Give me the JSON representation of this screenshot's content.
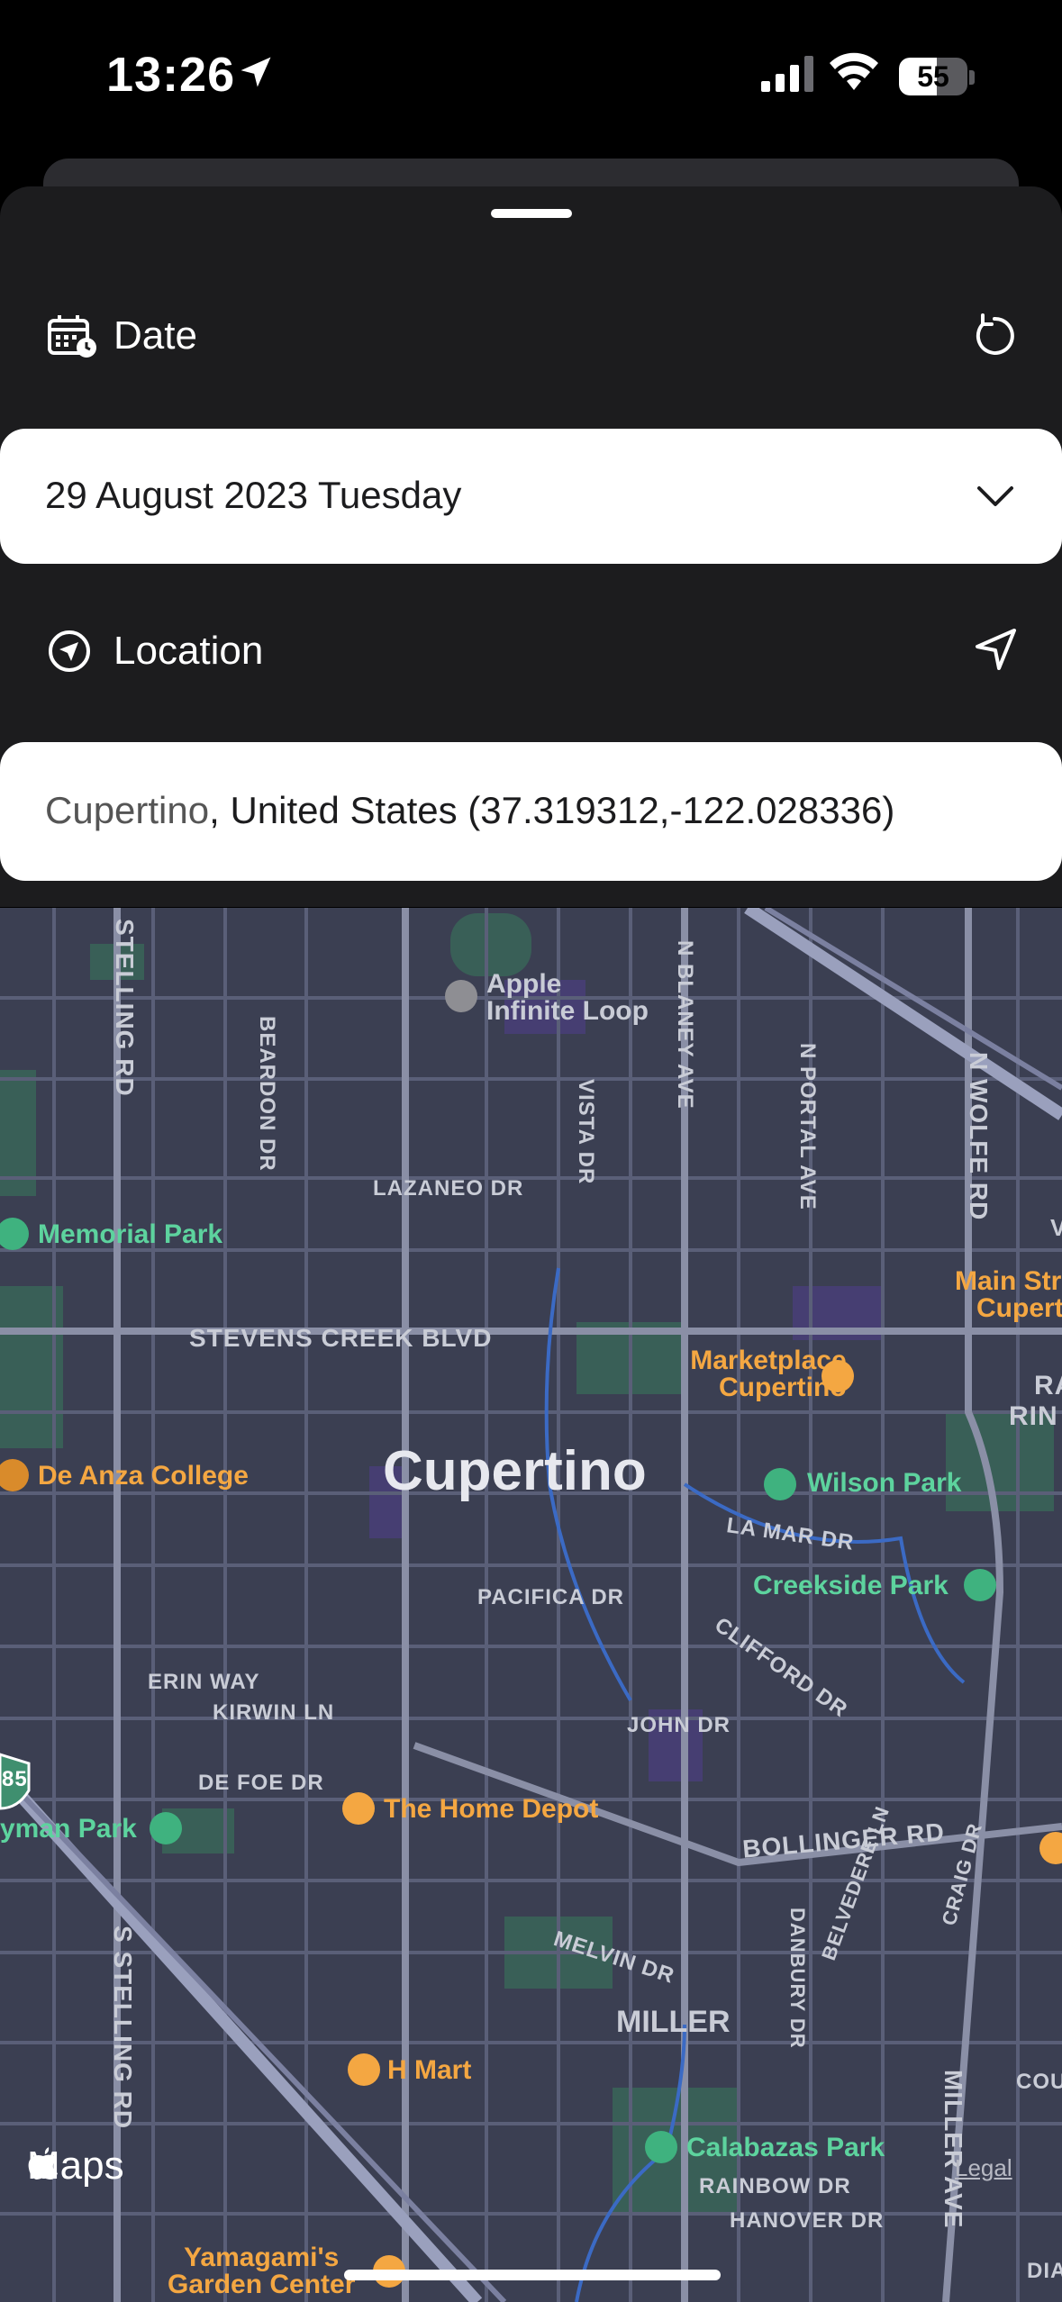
{
  "status_bar": {
    "time": "13:26",
    "battery": "55",
    "battery_level": 0.55
  },
  "date_section": {
    "label": "Date",
    "value": "29 August 2023 Tuesday"
  },
  "location_section": {
    "label": "Location",
    "place": "Cupertino",
    "rest": ", United States (37.319312,-122.028336)"
  },
  "map": {
    "city": "Cupertino",
    "district": "MILLER",
    "attribution": "Maps",
    "legal": "Legal",
    "highway_shield": "85",
    "streets": {
      "stelling_top": "STELLING RD",
      "stelling_bottom": "S STELLING RD",
      "beardon": "BEARDON DR",
      "lazaneo": "LAZANEO DR",
      "vista": "VISTA DR",
      "blaney": "N BLANEY AVE",
      "portal": "N PORTAL AVE",
      "wolfe": "N WOLFE RD",
      "stevens": "STEVENS CREEK BLVD",
      "lamar": "LA MAR DR",
      "pacifica": "PACIFICA DR",
      "clifford": "CLIFFORD DR",
      "erin": "ERIN WAY",
      "kirwin": "KIRWIN LN",
      "john": "JOHN DR",
      "defoe": "DE FOE DR",
      "bollinger": "BOLLINGER RD",
      "melvin": "MELVIN DR",
      "belvedere": "BELVEDERE LN",
      "danbury": "DANBURY DR",
      "craig": "CRAIG DR",
      "miller_ave": "MILLER AVE",
      "rainbow": "RAINBOW DR",
      "hanover": "HANOVER DR",
      "cou": "COU",
      "dia": "DIA"
    },
    "pois": {
      "apple_line1": "Apple",
      "apple_line2": "Infinite Loop",
      "memorial": "Memorial Park",
      "marketplace_line1": "Marketplace",
      "marketplace_line2": "Cupertino",
      "main_line1": "Main Str",
      "main_line2": "Cupert",
      "deanza": "De Anza College",
      "wilson": "Wilson Park",
      "creekside": "Creekside Park",
      "homedepot": "The Home Depot",
      "wyman": "yman Park",
      "hmart": "H Mart",
      "calabazas": "Calabazas Park",
      "yamagami_line1": "Yamagami's",
      "yamagami_line2": "Garden Center",
      "ra": "RA",
      "rin": "RIN",
      "v": "V"
    }
  }
}
